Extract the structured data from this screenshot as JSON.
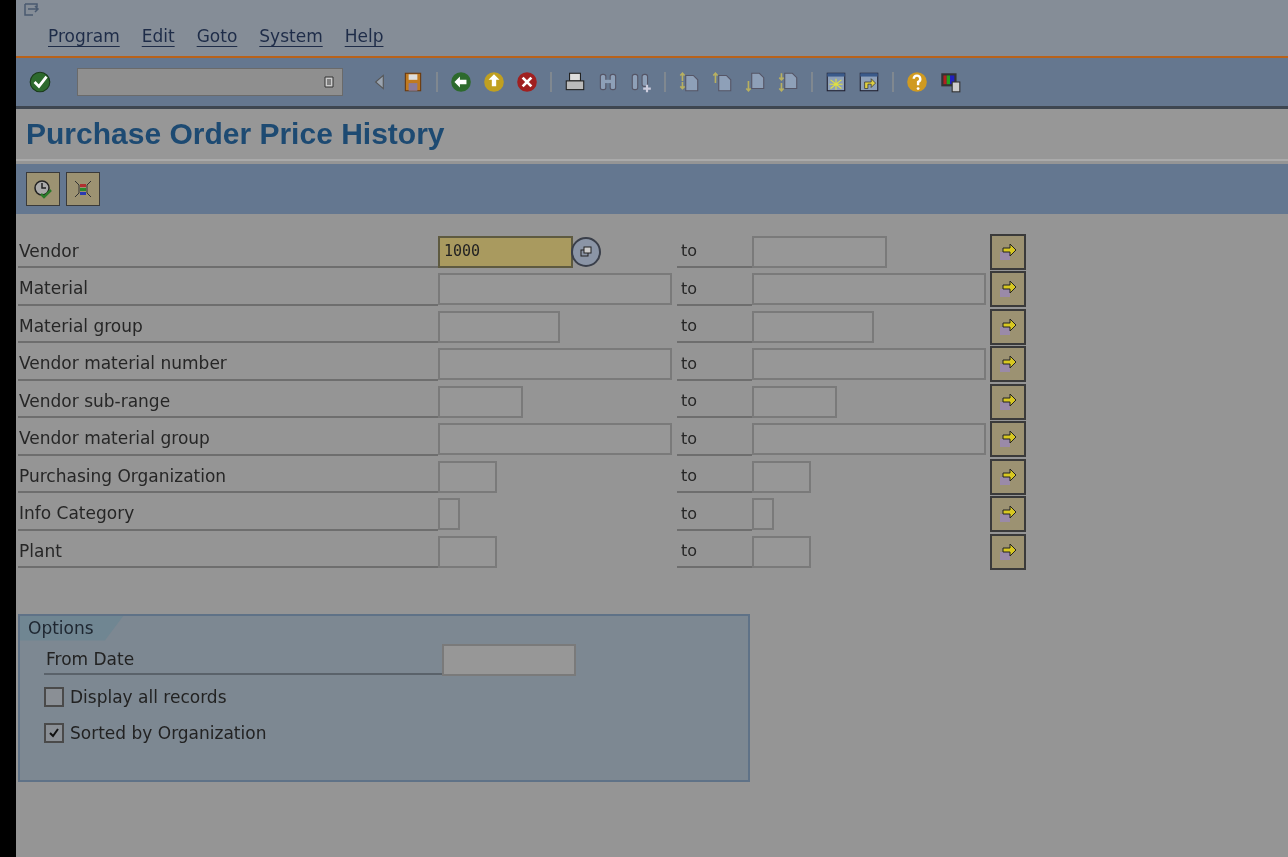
{
  "menu": [
    {
      "label": "Program"
    },
    {
      "label": "Edit"
    },
    {
      "label": "Goto"
    },
    {
      "label": "System"
    },
    {
      "label": "Help"
    }
  ],
  "title": "Purchase Order Price History",
  "selection_rows": [
    {
      "label": "Vendor",
      "low": {
        "value": "1000",
        "focused": true
      },
      "to_label": "to"
    },
    {
      "label": "Material",
      "low": {
        "focused": false
      },
      "to_label": "to"
    },
    {
      "label": "Material group",
      "low": {
        "focused": false
      },
      "to_label": "to"
    },
    {
      "label": "Vendor material number",
      "low": {
        "focused": false
      },
      "to_label": "to"
    },
    {
      "label": "Vendor sub-range",
      "low": {
        "focused": false
      },
      "to_label": "to"
    },
    {
      "label": "Vendor material group",
      "low": {
        "focused": false
      },
      "to_label": "to"
    },
    {
      "label": "Purchasing Organization",
      "low": {
        "focused": false
      },
      "to_label": "to"
    },
    {
      "label": "Info Category",
      "low": {
        "focused": false
      },
      "to_label": "to"
    },
    {
      "label": "Plant",
      "low": {
        "focused": false
      },
      "to_label": "to"
    }
  ],
  "options": {
    "title": "Options",
    "from_date": {
      "label": "From Date"
    },
    "checkboxes": [
      {
        "label": "Display all records",
        "checked": false
      },
      {
        "label": "Sorted by Organization",
        "checked": true
      }
    ]
  }
}
